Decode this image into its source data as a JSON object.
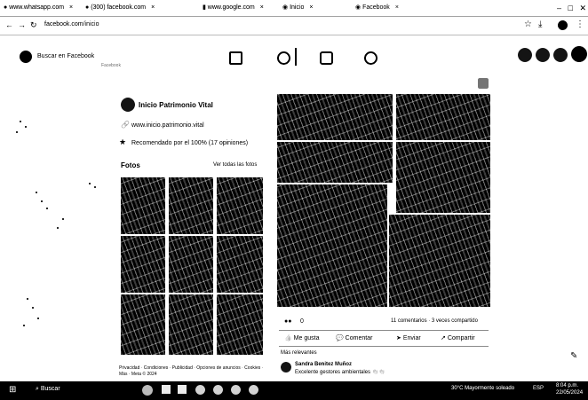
{
  "browser": {
    "tabs": [
      {
        "label": "www.whatsapp.com"
      },
      {
        "label": "(300) facebook.com"
      },
      {
        "label": "www.google.com"
      },
      {
        "label": "Inicio"
      },
      {
        "label": "Facebook"
      }
    ],
    "address": "facebook.com/inicio"
  },
  "facebook": {
    "search_placeholder": "Buscar en Facebook",
    "sidebar_caption": "Facebook"
  },
  "page": {
    "name": "Inicio Patrimonio Vital",
    "link": "www.inicio.patrimonio.vital",
    "recommendation": "Recomendado por el 100% (17 opiniones)",
    "photos_heading": "Fotos",
    "see_all_photos": "Ver todas las fotos",
    "footer_text": "Privacidad · Condiciones · Publicidad · Opciones de anuncios · Cookies · Más · Meta © 2024"
  },
  "post": {
    "reactions_count": "0",
    "comments_shares": "11 comentarios · 3 veces compartido",
    "actions": {
      "like": "Me gusta",
      "comment": "Comentar",
      "send": "Enviar",
      "share": "Compartir"
    },
    "relevance_filter": "Más relevantes",
    "comment_author": "Sandra Benitez Muñoz",
    "comment_text": "Excelente gestores ambientales 👏👏"
  },
  "taskbar": {
    "search_label": "Buscar",
    "weather": "30°C Mayormente soleado",
    "time": "8:04 p.m.",
    "date": "22/05/2024",
    "lang": "ESP"
  }
}
